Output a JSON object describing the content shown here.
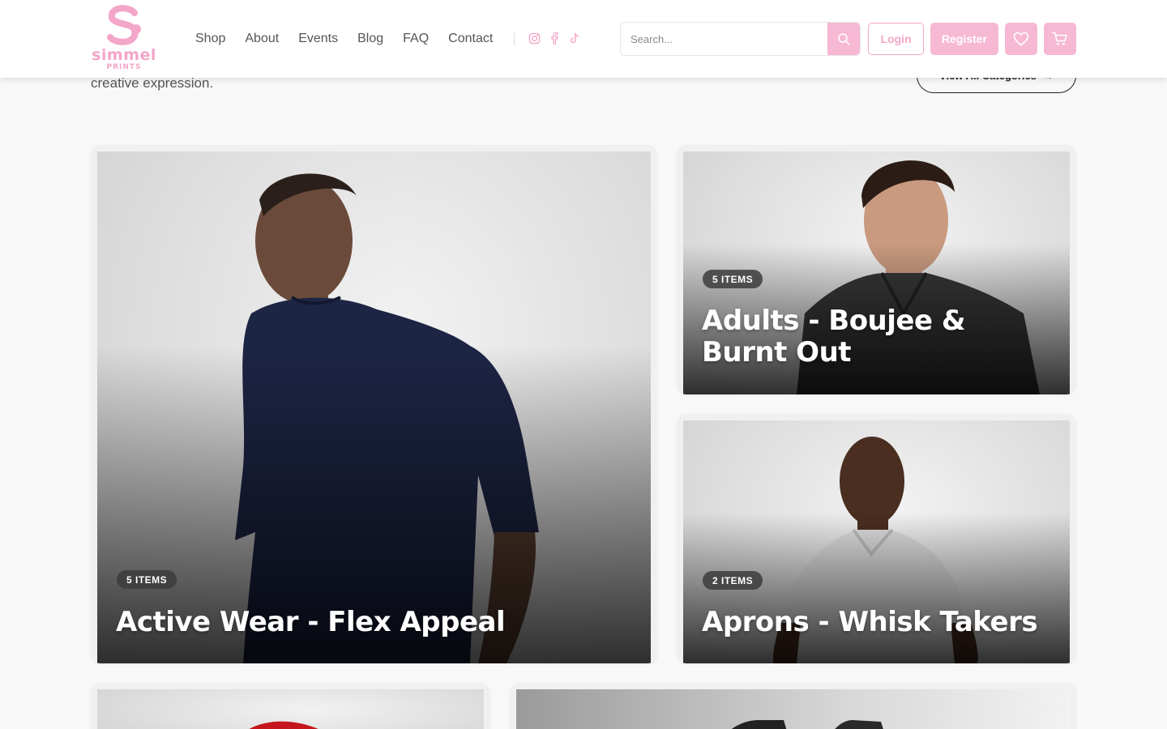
{
  "brand": {
    "name": "simmel",
    "sub": "PRINTS",
    "color": "#f3a6c8"
  },
  "nav": {
    "items": [
      {
        "label": "Shop"
      },
      {
        "label": "About"
      },
      {
        "label": "Events"
      },
      {
        "label": "Blog"
      },
      {
        "label": "FAQ"
      },
      {
        "label": "Contact"
      }
    ]
  },
  "social": [
    "instagram-icon",
    "facebook-icon",
    "tiktok-icon"
  ],
  "search": {
    "placeholder": "Search..."
  },
  "header_actions": {
    "login": "Login",
    "register": "Register"
  },
  "section": {
    "intro_tail": "creative expression.",
    "view_all": "View All Categories",
    "view_all_arrow": "→"
  },
  "categories": [
    {
      "count": "5 ITEMS",
      "title": "Active Wear - Flex Appeal",
      "figure": "man in navy t-shirt"
    },
    {
      "count": "5 ITEMS",
      "title": "Adults - Boujee & Burnt Out",
      "figure": "man in dark polo shirt"
    },
    {
      "count": "2 ITEMS",
      "title": "Aprons - Whisk Takers",
      "figure": "man in white polo shirt"
    }
  ],
  "colors": {
    "accent": "#f6b8d2",
    "page_bg": "#f8f8f8",
    "badge_bg": "#3c3c3c"
  }
}
